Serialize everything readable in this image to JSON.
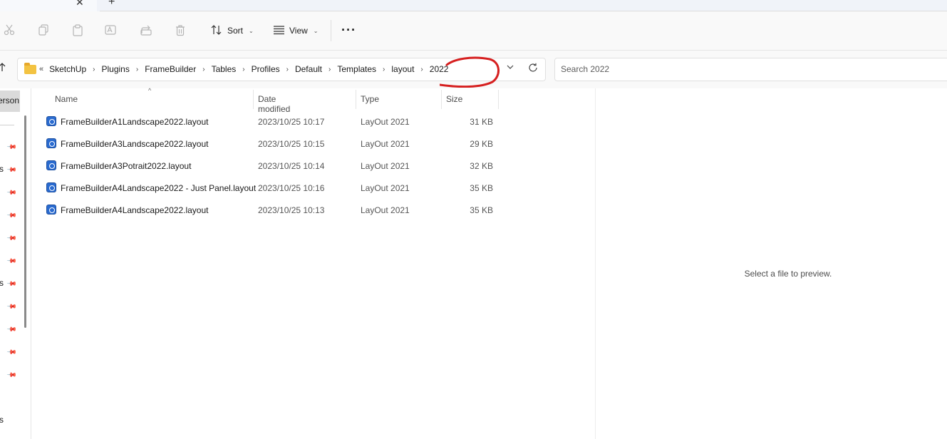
{
  "tabstrip": {
    "close_glyph": "✕",
    "new_tab_glyph": "+"
  },
  "toolbar": {
    "icons": [
      "cut-icon",
      "copy-icon",
      "paste-icon",
      "rename-icon",
      "share-icon",
      "delete-icon"
    ],
    "sort_label": "Sort",
    "view_label": "View",
    "more_label": "···"
  },
  "address": {
    "breadcrumbs": [
      "SketchUp",
      "Plugins",
      "FrameBuilder",
      "Tables",
      "Profiles",
      "Default",
      "Templates",
      "layout",
      "2022"
    ],
    "annotation_color": "#d62020"
  },
  "search": {
    "placeholder": "Search 2022"
  },
  "nav": {
    "selected_fragment": "erson",
    "fragments": [
      "s",
      "s",
      "s"
    ]
  },
  "columns": {
    "name": "Name",
    "date": "Date modified",
    "type": "Type",
    "size": "Size"
  },
  "files": [
    {
      "name": "FrameBuilderA1Landscape2022.layout",
      "date": "2023/10/25 10:17",
      "type": "LayOut 2021",
      "size": "31 KB"
    },
    {
      "name": "FrameBuilderA3Landscape2022.layout",
      "date": "2023/10/25 10:15",
      "type": "LayOut 2021",
      "size": "29 KB"
    },
    {
      "name": "FrameBuilderA3Potrait2022.layout",
      "date": "2023/10/25 10:14",
      "type": "LayOut 2021",
      "size": "32 KB"
    },
    {
      "name": "FrameBuilderA4Landscape2022 - Just Panel.layout",
      "date": "2023/10/25 10:16",
      "type": "LayOut 2021",
      "size": "35 KB"
    },
    {
      "name": "FrameBuilderA4Landscape2022.layout",
      "date": "2023/10/25 10:13",
      "type": "LayOut 2021",
      "size": "35 KB"
    }
  ],
  "preview": {
    "message": "Select a file to preview."
  }
}
